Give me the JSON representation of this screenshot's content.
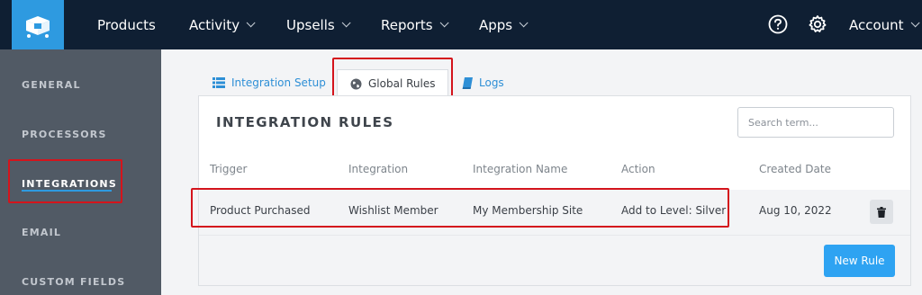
{
  "nav": {
    "items": [
      {
        "label": "Products",
        "dropdown": false
      },
      {
        "label": "Activity",
        "dropdown": true
      },
      {
        "label": "Upsells",
        "dropdown": true
      },
      {
        "label": "Reports",
        "dropdown": true
      },
      {
        "label": "Apps",
        "dropdown": true
      }
    ],
    "help_icon": "question-circle-icon",
    "settings_icon": "gear-icon",
    "account_label": "Account"
  },
  "sidebar": {
    "items": [
      {
        "label": "GENERAL"
      },
      {
        "label": "PROCESSORS"
      },
      {
        "label": "INTEGRATIONS",
        "active": true
      },
      {
        "label": "EMAIL"
      },
      {
        "label": "CUSTOM FIELDS"
      }
    ]
  },
  "tabs": [
    {
      "label": "Integration Setup",
      "icon": "list-icon"
    },
    {
      "label": "Global Rules",
      "icon": "globe-icon",
      "active": true
    },
    {
      "label": "Logs",
      "icon": "book-icon"
    }
  ],
  "panel": {
    "title": "INTEGRATION RULES",
    "search_placeholder": "Search term..."
  },
  "table": {
    "headers": [
      "Trigger",
      "Integration",
      "Integration Name",
      "Action",
      "Created Date"
    ],
    "rows": [
      [
        "Product Purchased",
        "Wishlist Member",
        "My Membership Site",
        "Add to Level: Silver",
        "Aug 10, 2022"
      ]
    ]
  },
  "new_rule_label": "New Rule",
  "colors": {
    "topbar": "#0f1f33",
    "accent": "#2e9ae0",
    "sidebar": "#515a65",
    "highlight": "#d4141c"
  }
}
